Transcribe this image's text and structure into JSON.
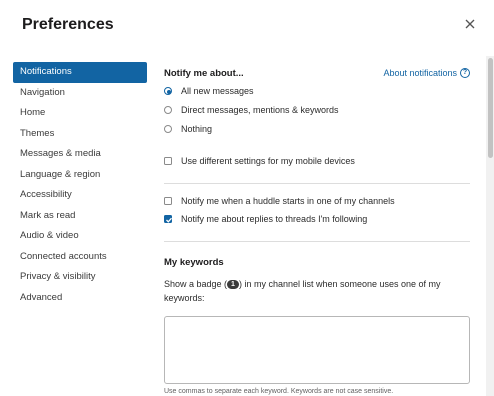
{
  "dialog": {
    "title": "Preferences"
  },
  "sidebar": {
    "items": [
      {
        "label": "Notifications",
        "active": true
      },
      {
        "label": "Navigation"
      },
      {
        "label": "Home"
      },
      {
        "label": "Themes"
      },
      {
        "label": "Messages & media"
      },
      {
        "label": "Language & region"
      },
      {
        "label": "Accessibility"
      },
      {
        "label": "Mark as read"
      },
      {
        "label": "Audio & video"
      },
      {
        "label": "Connected accounts"
      },
      {
        "label": "Privacy & visibility"
      },
      {
        "label": "Advanced"
      }
    ]
  },
  "notify": {
    "heading": "Notify me about...",
    "about_link": "About notifications",
    "options": [
      {
        "label": "All new messages",
        "selected": true
      },
      {
        "label": "Direct messages, mentions & keywords",
        "selected": false
      },
      {
        "label": "Nothing",
        "selected": false
      }
    ],
    "mobile_label": "Use different settings for my mobile devices",
    "mobile_checked": false
  },
  "huddle": {
    "label": "Notify me when a huddle starts in one of my channels",
    "checked": false
  },
  "threads": {
    "label": "Notify me about replies to threads I'm following",
    "checked": true
  },
  "keywords": {
    "heading": "My keywords",
    "desc_before": "Show a badge (",
    "badge": "1",
    "desc_after": ") in my channel list when someone uses one of my keywords:",
    "value": "",
    "hint": "Use commas to separate each keyword. Keywords are not case sensitive."
  },
  "colors": {
    "accent": "#1264a3",
    "active_nav_bg": "#1264a3"
  }
}
